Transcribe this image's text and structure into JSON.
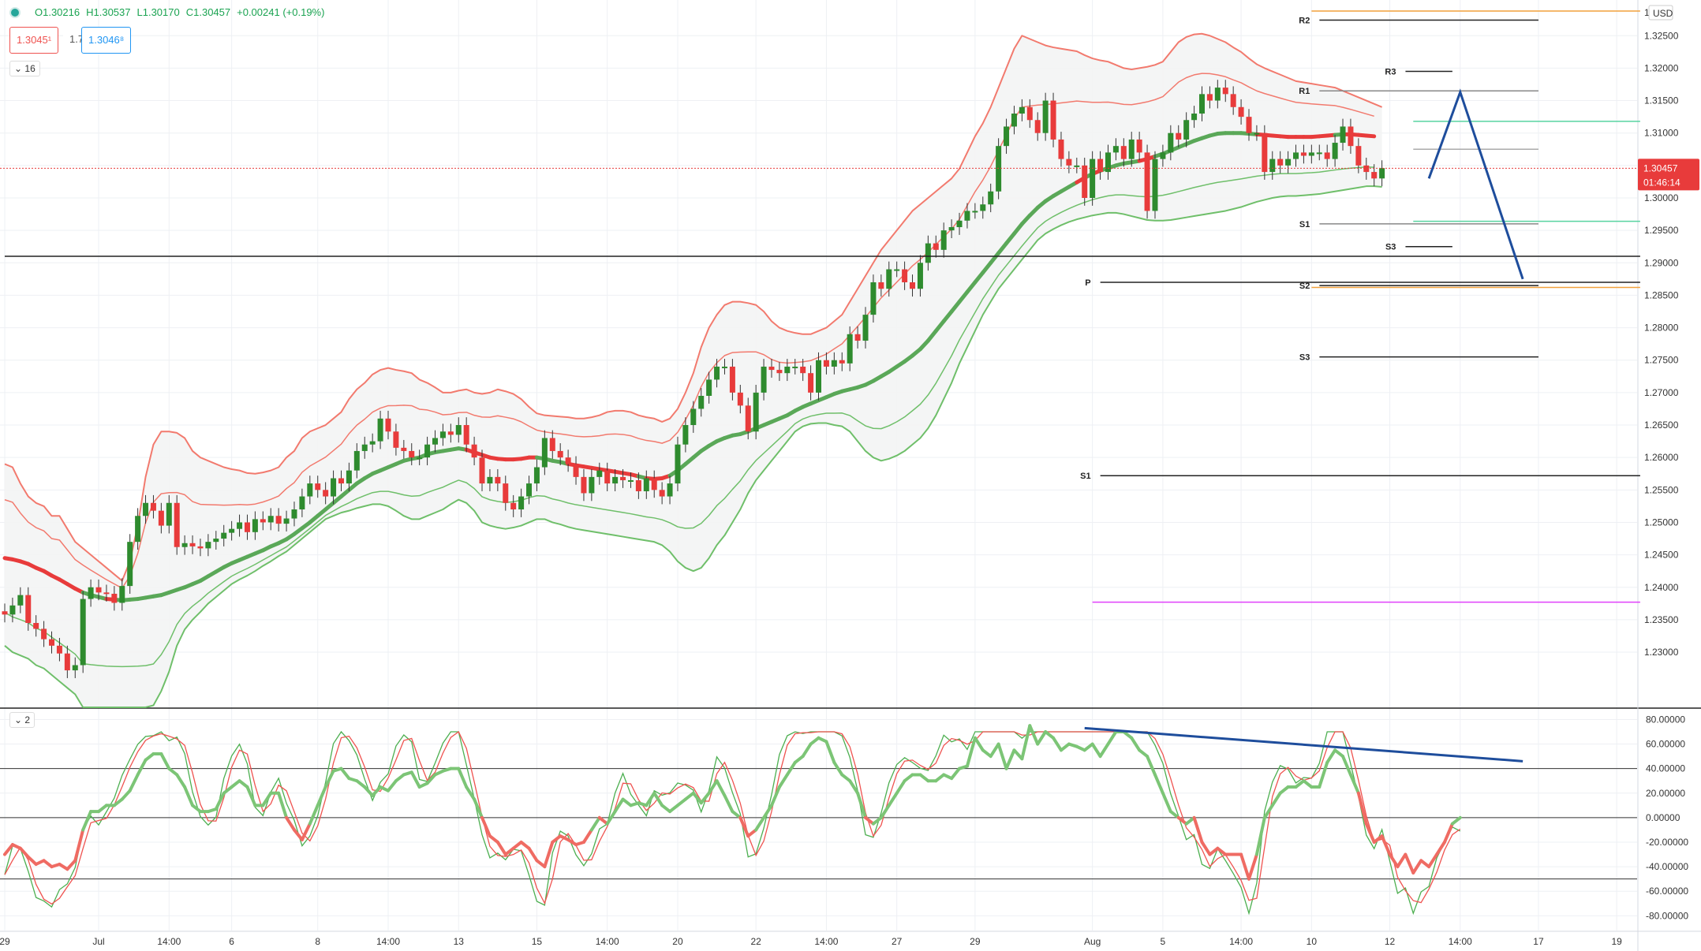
{
  "header": {
    "open": "O1.30216",
    "high": "H1.30537",
    "low": "L1.30170",
    "close": "C1.30457",
    "change": "+0.00241 (+0.19%)",
    "sell_price": "1.3045¹",
    "spread": "1.7",
    "buy_price": "1.3046⁸",
    "interval": "16",
    "indicator_pane": "2"
  },
  "price_axis": {
    "currency": "USD",
    "current_price": "1.30457",
    "countdown": "01:46:14",
    "top_partial": "1."
  },
  "colors": {
    "bull": "#2e8b2e",
    "bear": "#e83b3b",
    "upper_band": "#f27a6e",
    "lower_band": "#6fbf6a",
    "basis": "#5aa858",
    "projection": "#1e4d9c",
    "level_line": "#222222",
    "pink_level": "#e040fb",
    "orange_level": "#f2a13c",
    "teal_level": "#58d3a0"
  },
  "chart_data": {
    "type": "line",
    "title": "",
    "ylim": [
      1.2215,
      1.3305
    ],
    "price_ticks": [
      "1.32500",
      "1.32000",
      "1.31500",
      "1.31000",
      "1.30500",
      "1.30000",
      "1.29500",
      "1.29000",
      "1.28500",
      "1.28000",
      "1.27500",
      "1.27000",
      "1.26500",
      "1.26000",
      "1.25500",
      "1.25000",
      "1.24500",
      "1.24000",
      "1.23500",
      "1.23000"
    ],
    "price_tick_values": [
      1.325,
      1.32,
      1.315,
      1.31,
      1.305,
      1.3,
      1.295,
      1.29,
      1.285,
      1.28,
      1.275,
      1.27,
      1.265,
      1.26,
      1.255,
      1.25,
      1.245,
      1.24,
      1.235,
      1.23
    ],
    "x_labels": [
      "29",
      "Jul",
      "14:00",
      "6",
      "8",
      "14:00",
      "13",
      "15",
      "14:00",
      "20",
      "22",
      "14:00",
      "27",
      "29",
      "Aug",
      "5",
      "14:00",
      "10",
      "12",
      "14:00",
      "17",
      "19"
    ],
    "x_label_index": [
      0,
      12,
      21,
      29,
      40,
      49,
      58,
      68,
      77,
      86,
      96,
      105,
      114,
      124,
      139,
      148,
      158,
      167,
      177,
      186,
      196,
      206
    ],
    "close_series": [
      1.2358,
      1.2372,
      1.2388,
      1.2345,
      1.2336,
      1.232,
      1.231,
      1.2298,
      1.2272,
      1.228,
      1.2382,
      1.24,
      1.2392,
      1.239,
      1.2376,
      1.2402,
      1.247,
      1.251,
      1.253,
      1.2518,
      1.2495,
      1.253,
      1.2462,
      1.2468,
      1.2463,
      1.246,
      1.247,
      1.2475,
      1.2484,
      1.249,
      1.25,
      1.2485,
      1.2505,
      1.25,
      1.251,
      1.2498,
      1.2506,
      1.252,
      1.254,
      1.256,
      1.255,
      1.254,
      1.2568,
      1.256,
      1.258,
      1.261,
      1.262,
      1.2625,
      1.266,
      1.264,
      1.2615,
      1.261,
      1.26,
      1.26,
      1.262,
      1.263,
      1.264,
      1.2635,
      1.265,
      1.262,
      1.26,
      1.256,
      1.257,
      1.256,
      1.253,
      1.252,
      1.254,
      1.256,
      1.2585,
      1.263,
      1.261,
      1.26,
      1.259,
      1.257,
      1.2545,
      1.257,
      1.258,
      1.256,
      1.257,
      1.2565,
      1.2565,
      1.2548,
      1.2568,
      1.255,
      1.254,
      1.256,
      1.262,
      1.265,
      1.2675,
      1.2695,
      1.272,
      1.274,
      1.274,
      1.27,
      1.268,
      1.264,
      1.27,
      1.274,
      1.2735,
      1.273,
      1.274,
      1.274,
      1.273,
      1.27,
      1.275,
      1.274,
      1.275,
      1.2745,
      1.279,
      1.278,
      1.282,
      1.287,
      1.286,
      1.289,
      1.289,
      1.287,
      1.286,
      1.29,
      1.293,
      1.292,
      1.295,
      1.2955,
      1.2965,
      1.298,
      1.298,
      1.299,
      1.301,
      1.308,
      1.311,
      1.313,
      1.314,
      1.312,
      1.31,
      1.315,
      1.309,
      1.306,
      1.305,
      1.305,
      1.3,
      1.306,
      1.304,
      1.307,
      1.308,
      1.306,
      1.309,
      1.307,
      1.298,
      1.306,
      1.307,
      1.31,
      1.309,
      1.312,
      1.313,
      1.316,
      1.315,
      1.317,
      1.316,
      1.314,
      1.3125,
      1.31,
      1.31,
      1.304,
      1.306,
      1.305,
      1.306,
      1.307,
      1.3065,
      1.307,
      1.307,
      1.306,
      1.3085,
      1.311,
      1.308,
      1.305,
      1.304,
      1.303,
      1.3046
    ],
    "series": [
      {
        "name": "",
        "role": "price_candles"
      },
      {
        "name": "",
        "role": "upper_band",
        "values": [
          1.259,
          1.2585,
          1.256,
          1.254,
          1.253,
          1.2525,
          1.251,
          1.251,
          1.249,
          1.247,
          1.246,
          1.245,
          1.244,
          1.243,
          1.242,
          1.241,
          1.244,
          1.2495,
          1.257,
          1.262,
          1.264,
          1.264,
          1.2638,
          1.263,
          1.261,
          1.26,
          1.2595,
          1.259,
          1.2585,
          1.2582,
          1.258,
          1.2576,
          1.2575,
          1.2577,
          1.258,
          1.2585,
          1.26,
          1.261,
          1.263,
          1.264,
          1.2645,
          1.265,
          1.266,
          1.267,
          1.269,
          1.2705,
          1.2715,
          1.2728,
          1.2735,
          1.2738,
          1.2735,
          1.2733,
          1.273,
          1.272,
          1.2715,
          1.2708,
          1.27,
          1.27,
          1.2703,
          1.2705,
          1.27,
          1.2698,
          1.27,
          1.2705,
          1.2702,
          1.2698,
          1.269,
          1.2678,
          1.2668,
          1.2665,
          1.2664,
          1.2663,
          1.2662,
          1.266,
          1.266,
          1.2662,
          1.2665,
          1.267,
          1.2672,
          1.2672,
          1.267,
          1.2665,
          1.2662,
          1.266,
          1.2655,
          1.266,
          1.2675,
          1.27,
          1.273,
          1.277,
          1.28,
          1.282,
          1.2835,
          1.284,
          1.284,
          1.2838,
          1.2835,
          1.2825,
          1.281,
          1.28,
          1.2795,
          1.2792,
          1.279,
          1.279,
          1.2795,
          1.28,
          1.281,
          1.282,
          1.284,
          1.286,
          1.288,
          1.29,
          1.292,
          1.2935,
          1.295,
          1.2965,
          1.298,
          1.299,
          1.3,
          1.301,
          1.302,
          1.303,
          1.3045,
          1.307,
          1.3095,
          1.3115,
          1.314,
          1.317,
          1.32,
          1.323,
          1.325,
          1.3245,
          1.324,
          1.3235,
          1.3232,
          1.323,
          1.3228,
          1.3226,
          1.322,
          1.3215,
          1.3212,
          1.321,
          1.3205,
          1.32,
          1.3198,
          1.32,
          1.3202,
          1.3205,
          1.321,
          1.3225,
          1.324,
          1.3248,
          1.3252,
          1.3253,
          1.325,
          1.3245,
          1.324,
          1.3232,
          1.3225,
          1.3215,
          1.3206,
          1.32,
          1.3195,
          1.319,
          1.3185,
          1.318,
          1.3178,
          1.3176,
          1.3174,
          1.3172,
          1.317,
          1.3165,
          1.316,
          1.3155,
          1.315,
          1.3145,
          1.314
        ]
      },
      {
        "name": "",
        "role": "basis",
        "values": [
          1.2445,
          1.2443,
          1.244,
          1.2436,
          1.243,
          1.2425,
          1.2418,
          1.2412,
          1.2405,
          1.2398,
          1.2392,
          1.2388,
          1.2385,
          1.2382,
          1.2381,
          1.238,
          1.2381,
          1.2382,
          1.2384,
          1.2386,
          1.2388,
          1.2392,
          1.2396,
          1.24,
          1.2405,
          1.241,
          1.2417,
          1.2424,
          1.2431,
          1.2437,
          1.2442,
          1.2447,
          1.2452,
          1.2457,
          1.2463,
          1.2468,
          1.2474,
          1.2482,
          1.2491,
          1.25,
          1.251,
          1.252,
          1.253,
          1.254,
          1.255,
          1.256,
          1.2568,
          1.2575,
          1.258,
          1.2585,
          1.259,
          1.2595,
          1.2598,
          1.26,
          1.2605,
          1.2608,
          1.261,
          1.2612,
          1.2614,
          1.2612,
          1.2608,
          1.2604,
          1.26,
          1.2598,
          1.2597,
          1.2597,
          1.2598,
          1.26,
          1.26,
          1.2598,
          1.2595,
          1.2593,
          1.259,
          1.2588,
          1.2586,
          1.2584,
          1.2582,
          1.258,
          1.2578,
          1.2576,
          1.2574,
          1.2571,
          1.2568,
          1.2567,
          1.2568,
          1.2572,
          1.258,
          1.259,
          1.26,
          1.261,
          1.2618,
          1.2625,
          1.263,
          1.2634,
          1.2636,
          1.264,
          1.2645,
          1.265,
          1.2655,
          1.266,
          1.2665,
          1.2672,
          1.2678,
          1.2683,
          1.2688,
          1.2693,
          1.2698,
          1.2702,
          1.2705,
          1.2708,
          1.2712,
          1.2718,
          1.2725,
          1.2732,
          1.274,
          1.2748,
          1.2757,
          1.2767,
          1.278,
          1.2795,
          1.281,
          1.2825,
          1.284,
          1.2855,
          1.287,
          1.2885,
          1.29,
          1.2915,
          1.293,
          1.2945,
          1.296,
          1.2973,
          1.2985,
          1.2995,
          1.3003,
          1.301,
          1.3017,
          1.3024,
          1.3031,
          1.3037,
          1.3042,
          1.3046,
          1.305,
          1.3053,
          1.3055,
          1.3057,
          1.306,
          1.3064,
          1.3068,
          1.3073,
          1.3078,
          1.3083,
          1.3088,
          1.3092,
          1.3096,
          1.3099,
          1.31,
          1.31,
          1.31,
          1.3099,
          1.3098,
          1.3097,
          1.3096,
          1.3095,
          1.3094,
          1.3094,
          1.3094,
          1.3094,
          1.3095,
          1.3096,
          1.3097,
          1.3098,
          1.3098,
          1.3097,
          1.3096,
          1.3095
        ]
      },
      {
        "name": "",
        "role": "lower_band",
        "values": [
          1.231,
          1.23,
          1.2295,
          1.229,
          1.228,
          1.2275,
          1.2265,
          1.2255,
          1.2245,
          1.2235,
          1.2215,
          1.2215,
          1.2215,
          1.2215,
          1.2215,
          1.2215,
          1.2215,
          1.2215,
          1.2215,
          1.2218,
          1.224,
          1.227,
          1.231,
          1.2335,
          1.235,
          1.2362,
          1.2375,
          1.2385,
          1.2395,
          1.2405,
          1.2412,
          1.2418,
          1.2425,
          1.2433,
          1.244,
          1.2448,
          1.2455,
          1.2465,
          1.2475,
          1.2485,
          1.2495,
          1.2505,
          1.251,
          1.2515,
          1.2518,
          1.2522,
          1.2525,
          1.2528,
          1.2528,
          1.2525,
          1.2518,
          1.251,
          1.2505,
          1.2505,
          1.251,
          1.2515,
          1.252,
          1.2528,
          1.2535,
          1.253,
          1.2518,
          1.25,
          1.2495,
          1.2492,
          1.249,
          1.2492,
          1.2495,
          1.25,
          1.2505,
          1.2505,
          1.25,
          1.2497,
          1.2493,
          1.249,
          1.2488,
          1.2486,
          1.2484,
          1.2482,
          1.248,
          1.2478,
          1.2476,
          1.2474,
          1.2472,
          1.247,
          1.2465,
          1.2455,
          1.244,
          1.243,
          1.2425,
          1.243,
          1.2445,
          1.2465,
          1.248,
          1.25,
          1.252,
          1.2545,
          1.2565,
          1.258,
          1.2595,
          1.261,
          1.2625,
          1.264,
          1.2648,
          1.2652,
          1.2653,
          1.2653,
          1.265,
          1.2648,
          1.264,
          1.2625,
          1.261,
          1.26,
          1.2595,
          1.2598,
          1.2603,
          1.261,
          1.262,
          1.263,
          1.2645,
          1.2665,
          1.269,
          1.2715,
          1.2745,
          1.277,
          1.2795,
          1.282,
          1.284,
          1.286,
          1.2875,
          1.289,
          1.2905,
          1.292,
          1.2935,
          1.2945,
          1.2952,
          1.2958,
          1.2963,
          1.2967,
          1.297,
          1.2973,
          1.2975,
          1.2977,
          1.2977,
          1.2975,
          1.2972,
          1.2969,
          1.2966,
          1.2965,
          1.2965,
          1.2966,
          1.2968,
          1.297,
          1.2972,
          1.2974,
          1.2976,
          1.2978,
          1.298,
          1.2983,
          1.2986,
          1.299,
          1.2994,
          1.2997,
          1.3,
          1.3002,
          1.3003,
          1.3003,
          1.3004,
          1.3005,
          1.3006,
          1.3008,
          1.301,
          1.3012,
          1.3014,
          1.3016,
          1.3018,
          1.3018,
          1.3017
        ]
      }
    ],
    "horizontal_levels": [
      {
        "label": "R2",
        "value": 1.3274,
        "x_start_index": 167,
        "x_end_index": 196,
        "color": "#222222"
      },
      {
        "label": "R3",
        "value": 1.3195,
        "x_start_index": 178,
        "x_end_index": 185,
        "color": "#222222"
      },
      {
        "label": "R1",
        "value": 1.3165,
        "x_start_index": 167,
        "x_end_index": 196,
        "color": "#888888"
      },
      {
        "label": "S1",
        "value": 1.296,
        "x_start_index": 167,
        "x_end_index": 196,
        "color": "#888888"
      },
      {
        "label": "S3",
        "value": 1.2925,
        "x_start_index": 178,
        "x_end_index": 185,
        "color": "#222222"
      },
      {
        "label": "P",
        "value": 1.287,
        "x_start_index": 139,
        "x_end_index": 209,
        "color": "#222222"
      },
      {
        "label": "S2",
        "value": 1.2865,
        "x_start_index": 167,
        "x_end_index": 196,
        "color": "#222222"
      },
      {
        "label": "S3",
        "value": 1.2755,
        "x_start_index": 167,
        "x_end_index": 196,
        "color": "#222222"
      },
      {
        "label": "S1",
        "value": 1.2572,
        "x_start_index": 139,
        "x_end_index": 209,
        "color": "#222222"
      },
      {
        "label": "",
        "value": 1.291,
        "x_start_index": 0,
        "x_end_index": 209,
        "color": "#222222"
      },
      {
        "label": "",
        "value": 1.2377,
        "x_start_index": 139,
        "x_end_index": 209,
        "color": "#e040fb"
      },
      {
        "label": "",
        "value": 1.3288,
        "x_start_index": 167,
        "x_end_index": 209,
        "color": "#f2a13c"
      },
      {
        "label": "",
        "value": 1.2862,
        "x_start_index": 167,
        "x_end_index": 209,
        "color": "#f2a13c"
      },
      {
        "label": "",
        "value": 1.3118,
        "x_start_index": 180,
        "x_end_index": 209,
        "color": "#58d3a0"
      },
      {
        "label": "",
        "value": 1.2964,
        "x_start_index": 180,
        "x_end_index": 209,
        "color": "#58d3a0"
      },
      {
        "label": "",
        "value": 1.3075,
        "x_start_index": 180,
        "x_end_index": 196,
        "color": "#aaaaaa"
      }
    ],
    "projection_path": [
      {
        "x_index": 182,
        "value": 1.303
      },
      {
        "x_index": 186,
        "value": 1.3163
      },
      {
        "x_index": 194,
        "value": 1.2875
      }
    ],
    "oscillator": {
      "ylim": [
        -92,
        88
      ],
      "ticks": [
        "80.00000",
        "60.00000",
        "40.00000",
        "20.00000",
        "0.00000",
        "-20.00000",
        "-40.00000",
        "-60.00000",
        "-80.00000"
      ],
      "tick_values": [
        80,
        60,
        40,
        20,
        0,
        -20,
        -40,
        -60,
        -80
      ],
      "guide_levels": [
        40,
        0,
        -50
      ],
      "main_values": [
        -30,
        -22,
        -25,
        -32,
        -38,
        -35,
        -40,
        -38,
        -42,
        -35,
        -10,
        5,
        5,
        10,
        10,
        15,
        22,
        35,
        47,
        52,
        52,
        40,
        35,
        25,
        10,
        5,
        5,
        7,
        20,
        25,
        30,
        25,
        10,
        10,
        20,
        20,
        0,
        -10,
        -18,
        -5,
        10,
        25,
        38,
        40,
        32,
        30,
        25,
        18,
        25,
        22,
        30,
        35,
        37,
        25,
        28,
        35,
        38,
        40,
        40,
        25,
        15,
        0,
        -15,
        -20,
        -30,
        -25,
        -20,
        -25,
        -35,
        -40,
        -20,
        -15,
        -18,
        -22,
        -20,
        -10,
        0,
        -5,
        5,
        15,
        10,
        12,
        10,
        20,
        10,
        5,
        10,
        15,
        20,
        12,
        20,
        30,
        18,
        5,
        0,
        -15,
        -10,
        0,
        10,
        25,
        35,
        45,
        50,
        60,
        65,
        62,
        45,
        35,
        30,
        20,
        0,
        -5,
        0,
        10,
        20,
        30,
        35,
        35,
        30,
        30,
        35,
        32,
        40,
        42,
        65,
        55,
        50,
        60,
        40,
        55,
        48,
        75,
        60,
        70,
        65,
        55,
        60,
        58,
        55,
        60,
        50,
        60,
        70,
        70,
        65,
        55,
        50,
        35,
        20,
        5,
        0,
        -5,
        0,
        -20,
        -30,
        -25,
        -30,
        -30,
        -30,
        -50,
        -30,
        0,
        10,
        20,
        25,
        25,
        30,
        25,
        25,
        45,
        55,
        50,
        35,
        20,
        -5,
        -20,
        -15,
        -30,
        -40,
        -30,
        -45,
        -35,
        -40,
        -30,
        -20,
        -5,
        0
      ],
      "trend_line": [
        {
          "x_index": 138,
          "value": 73
        },
        {
          "x_index": 194,
          "value": 46
        }
      ]
    }
  }
}
